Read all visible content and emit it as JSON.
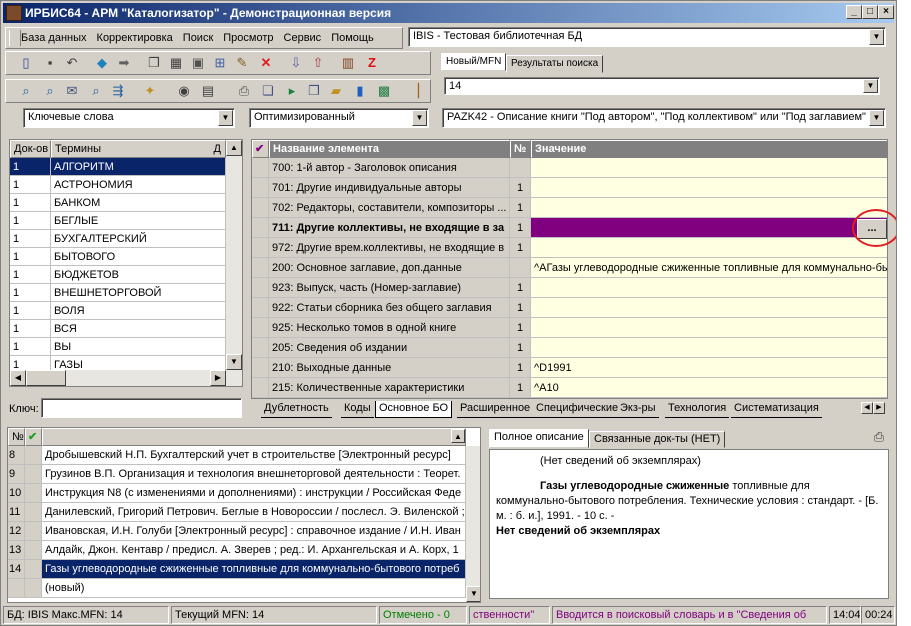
{
  "title": "ИРБИС64 - АРМ \"Каталогизатор\" - Демонстрационная версия",
  "window_buttons": {
    "minimize": "_",
    "maximize": "□",
    "close": "×"
  },
  "menu": [
    "База данных",
    "Корректировка",
    "Поиск",
    "Просмотр",
    "Сервис",
    "Помощь"
  ],
  "db_combo": "IBIS - Тестовая библиотечная БД",
  "top_tabs": [
    "Новый/MFN",
    "Результаты поиска"
  ],
  "mfn_combo": "14",
  "search_combo": "Ключевые слова",
  "mode_combo": "Оптимизированный",
  "worksheet_combo": "PAZK42 - Описание книги \"Под автором\", \"Под коллективом\" или \"Под заглавием\"",
  "terms": {
    "col_docs": "Док-ов",
    "col_terms": "Термины",
    "pin": "Д",
    "rows": [
      {
        "n": "1",
        "t": "АЛГОРИТМ"
      },
      {
        "n": "1",
        "t": "АСТРОНОМИЯ"
      },
      {
        "n": "1",
        "t": "БАНКОМ"
      },
      {
        "n": "1",
        "t": "БЕГЛЫЕ"
      },
      {
        "n": "1",
        "t": "БУХГАЛТЕРСКИЙ"
      },
      {
        "n": "1",
        "t": "БЫТОВОГО"
      },
      {
        "n": "1",
        "t": "БЮДЖЕТОВ"
      },
      {
        "n": "1",
        "t": "ВНЕШНЕТОРГОВОЙ"
      },
      {
        "n": "1",
        "t": "ВОЛЯ"
      },
      {
        "n": "1",
        "t": "ВСЯ"
      },
      {
        "n": "1",
        "t": "ВЫ"
      },
      {
        "n": "1",
        "t": "ГАЗЫ"
      }
    ],
    "key_label": "Ключ:"
  },
  "fields": {
    "col_name": "Название элемента",
    "col_num": "№",
    "col_value": "Значение",
    "ellipsis": "...",
    "rows": [
      {
        "name": "700: 1-й автор - Заголовок описания",
        "num": "",
        "value": ""
      },
      {
        "name": "701: Другие индивидуальные авторы",
        "num": "1",
        "value": ""
      },
      {
        "name": "702: Редакторы, составители, композиторы ...",
        "num": "1",
        "value": ""
      },
      {
        "name": "711: Другие коллективы, не входящие в за",
        "num": "1",
        "value": ""
      },
      {
        "name": "972: Другие врем.коллективы, не входящие в",
        "num": "1",
        "value": ""
      },
      {
        "name": "200: Основное заглавие, доп.данные",
        "num": "",
        "value": "^AГазы углеводородные сжиженные топливные для коммунально-бы"
      },
      {
        "name": "923: Выпуск, часть (Номер-заглавие)",
        "num": "1",
        "value": ""
      },
      {
        "name": "922: Статьи сборника без общего заглавия",
        "num": "1",
        "value": ""
      },
      {
        "name": "925: Несколько томов в одной книге",
        "num": "1",
        "value": ""
      },
      {
        "name": "205: Сведения об издании",
        "num": "1",
        "value": ""
      },
      {
        "name": "210: Выходные данные",
        "num": "1",
        "value": "^D1991"
      },
      {
        "name": "215: Количественные характеристики",
        "num": "1",
        "value": "^A10"
      }
    ]
  },
  "bottom_tabs": [
    "Дублетность",
    "Коды",
    "Основное БО",
    "Расширенное",
    "Специфические",
    "Экз-ры",
    "Технология",
    "Систематизация"
  ],
  "records": {
    "col_num": "№",
    "rows": [
      {
        "n": "8",
        "t": "Дробышевский Н.П. Бухгалтерский учет в строительстве [Электронный ресурс]"
      },
      {
        "n": "9",
        "t": "Грузинов В.П. Организация и технология внешнеторговой деятельности : Теорет."
      },
      {
        "n": "10",
        "t": "Инструкция N8  (с изменениями и дополнениями) : инструкции / Российская Феде"
      },
      {
        "n": "11",
        "t": "Данилевский, Григорий Петрович. Беглые в Новороссии / послесл. Э. Виленской ;"
      },
      {
        "n": "12",
        "t": "Ивановская, И.Н. Голуби [Электронный ресурс] : справочное издание / И.Н. Иван"
      },
      {
        "n": "13",
        "t": "Алдайк, Джон. Кентавр / предисл. А. Зверев ; ред.: И. Архангельская и А. Корх, 1"
      },
      {
        "n": "14",
        "t": "Газы углеводородные сжиженные топливные для коммунально-бытового потреб"
      },
      {
        "n": "",
        "t": "(новый)"
      }
    ]
  },
  "desc_tabs": [
    "Полное описание",
    "Связанные док-ты (НЕТ)"
  ],
  "description": {
    "line1": "(Нет сведений об экземплярах)",
    "title_bold": "Газы углеводородные сжиженные",
    "title_rest": " топливные для коммунально-бытового потребления. Технические условия : стандарт. - [Б. м. : б. и.], 1991. - 10 с. -",
    "footer": "Нет сведений об экземплярах"
  },
  "status": {
    "db": "БД: IBIS Макс.MFN: 14",
    "cur": "Текущий MFN: 14",
    "marked": "Отмечено - 0",
    "hint1": "ственности\"",
    "hint2": "Вводится в поисковый словарь и в \"Сведения об",
    "time": "14:04",
    "elapsed": "00:24"
  },
  "colors": {
    "selection": "#0a246a",
    "active_field": "#800080",
    "value_bg": "#ffffe1",
    "status_green": "#008000",
    "status_purple": "#800080"
  }
}
